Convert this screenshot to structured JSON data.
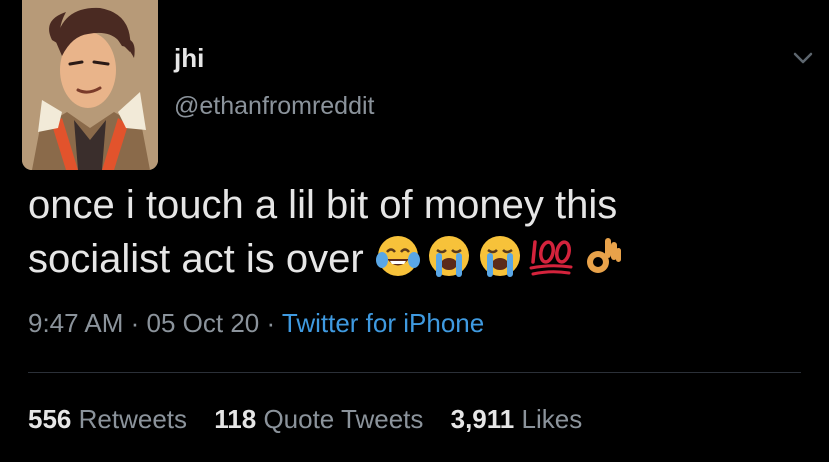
{
  "user": {
    "display_name": "jhi",
    "handle": "@ethanfromreddit"
  },
  "tweet": {
    "line1": "once i touch a lil bit of money this",
    "line2": "socialist act is over",
    "emojis": [
      "face-with-tears-of-joy",
      "loudly-crying-face",
      "loudly-crying-face",
      "hundred-points",
      "ok-hand"
    ]
  },
  "meta": {
    "time": "9:47 AM",
    "sep1": " · ",
    "date": "05 Oct 20",
    "sep2": " · ",
    "source": "Twitter for iPhone"
  },
  "stats": {
    "retweets_count": "556",
    "retweets_label": "Retweets",
    "quotes_count": "118",
    "quotes_label": "Quote Tweets",
    "likes_count": "3,911",
    "likes_label": "Likes"
  },
  "colors": {
    "background": "#000000",
    "text": "#e6e6e6",
    "secondary": "#8b939b",
    "link": "#3f9ae0",
    "divider": "#2b3038"
  }
}
